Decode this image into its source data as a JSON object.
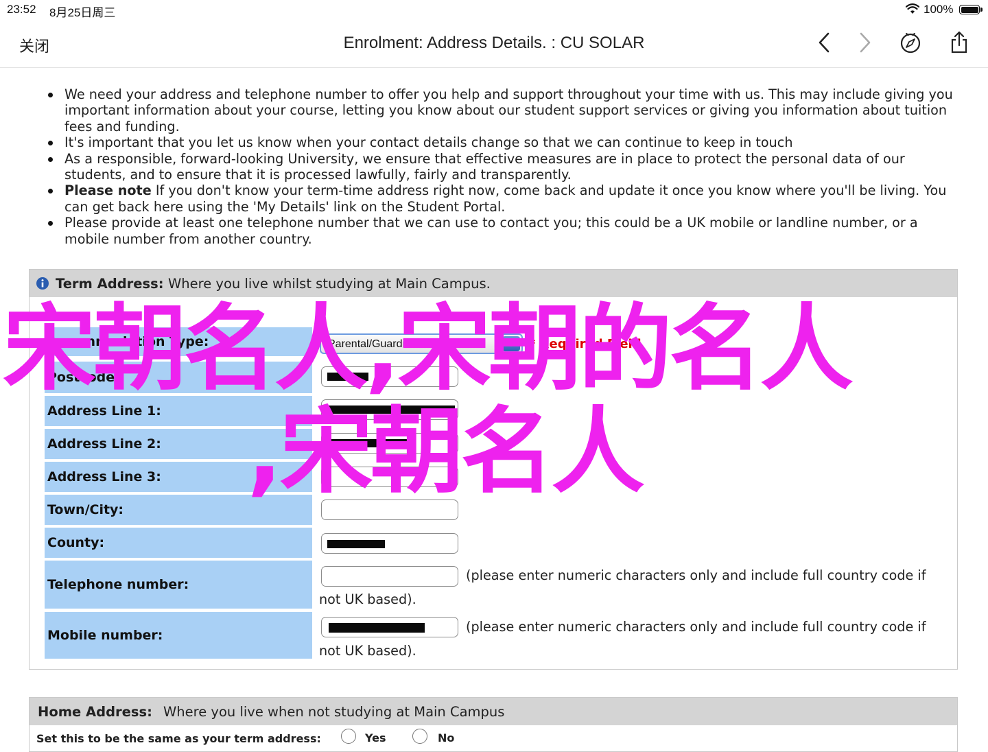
{
  "status_bar": {
    "time": "23:52",
    "date": "8月25日周三",
    "battery": "100%"
  },
  "nav": {
    "close_label": "关闭",
    "title": "Enrolment: Address Details. : CU SOLAR",
    "icons": [
      "back-icon",
      "forward-icon",
      "compass-icon",
      "share-icon"
    ]
  },
  "notes": [
    {
      "bold": "",
      "text": "We need your address and telephone number to offer you help and support throughout your time with us. This may include giving you important information about your course, letting you know about our student support services or giving you information about tuition fees and funding."
    },
    {
      "bold": "",
      "text": "It's important that you let us know when your contact details change so that we can continue to keep in touch"
    },
    {
      "bold": "",
      "text": "As a responsible, forward-looking University, we ensure that effective measures are in place to protect the personal data of our students, and to ensure that it is processed lawfully, fairly and transparently."
    },
    {
      "bold": "Please note",
      "text": " If you don't know your term-time address right now, come back and update it once you know where you'll be living. You can get back here using the 'My Details' link on the Student Portal."
    },
    {
      "bold": "",
      "text": "Please provide at least one telephone number that we can use to contact you; this could be a UK mobile or landline number, or a mobile number from another country."
    }
  ],
  "term_address": {
    "title": "Term Address:",
    "description": "Where you live whilst studying at Main Campus.",
    "accommodation_type": {
      "label": "Accommodation Type:",
      "value": "Parental/Guardian home",
      "required_text": "* Required Field"
    },
    "fields": [
      {
        "label": "Postcode:"
      },
      {
        "label": "Address Line 1:"
      },
      {
        "label": "Address Line 2:"
      },
      {
        "label": "Address Line 3:"
      },
      {
        "label": "Town/City:"
      },
      {
        "label": "County:"
      },
      {
        "label": "Telephone number:",
        "hint": "(please enter numeric characters only and include full country code if",
        "hint2": "not UK based)."
      },
      {
        "label": "Mobile number:",
        "hint": "(please enter numeric characters only and include full country code if",
        "hint2": "not UK based)."
      }
    ]
  },
  "home_address": {
    "title": "Home Address:",
    "description": "Where you live when not studying at Main Campus",
    "same_as_term": "Set this to be the same as your term address:",
    "options": [
      "Yes",
      "No"
    ]
  },
  "watermark": {
    "line1": "宋朝名人,宋朝的名人",
    "line2": ",宋朝名人"
  },
  "colors": {
    "label_bg": "#a9d0f5",
    "panel_header": "#d4d4d4",
    "watermark": "#ee22ee",
    "required": "#dd0000"
  }
}
